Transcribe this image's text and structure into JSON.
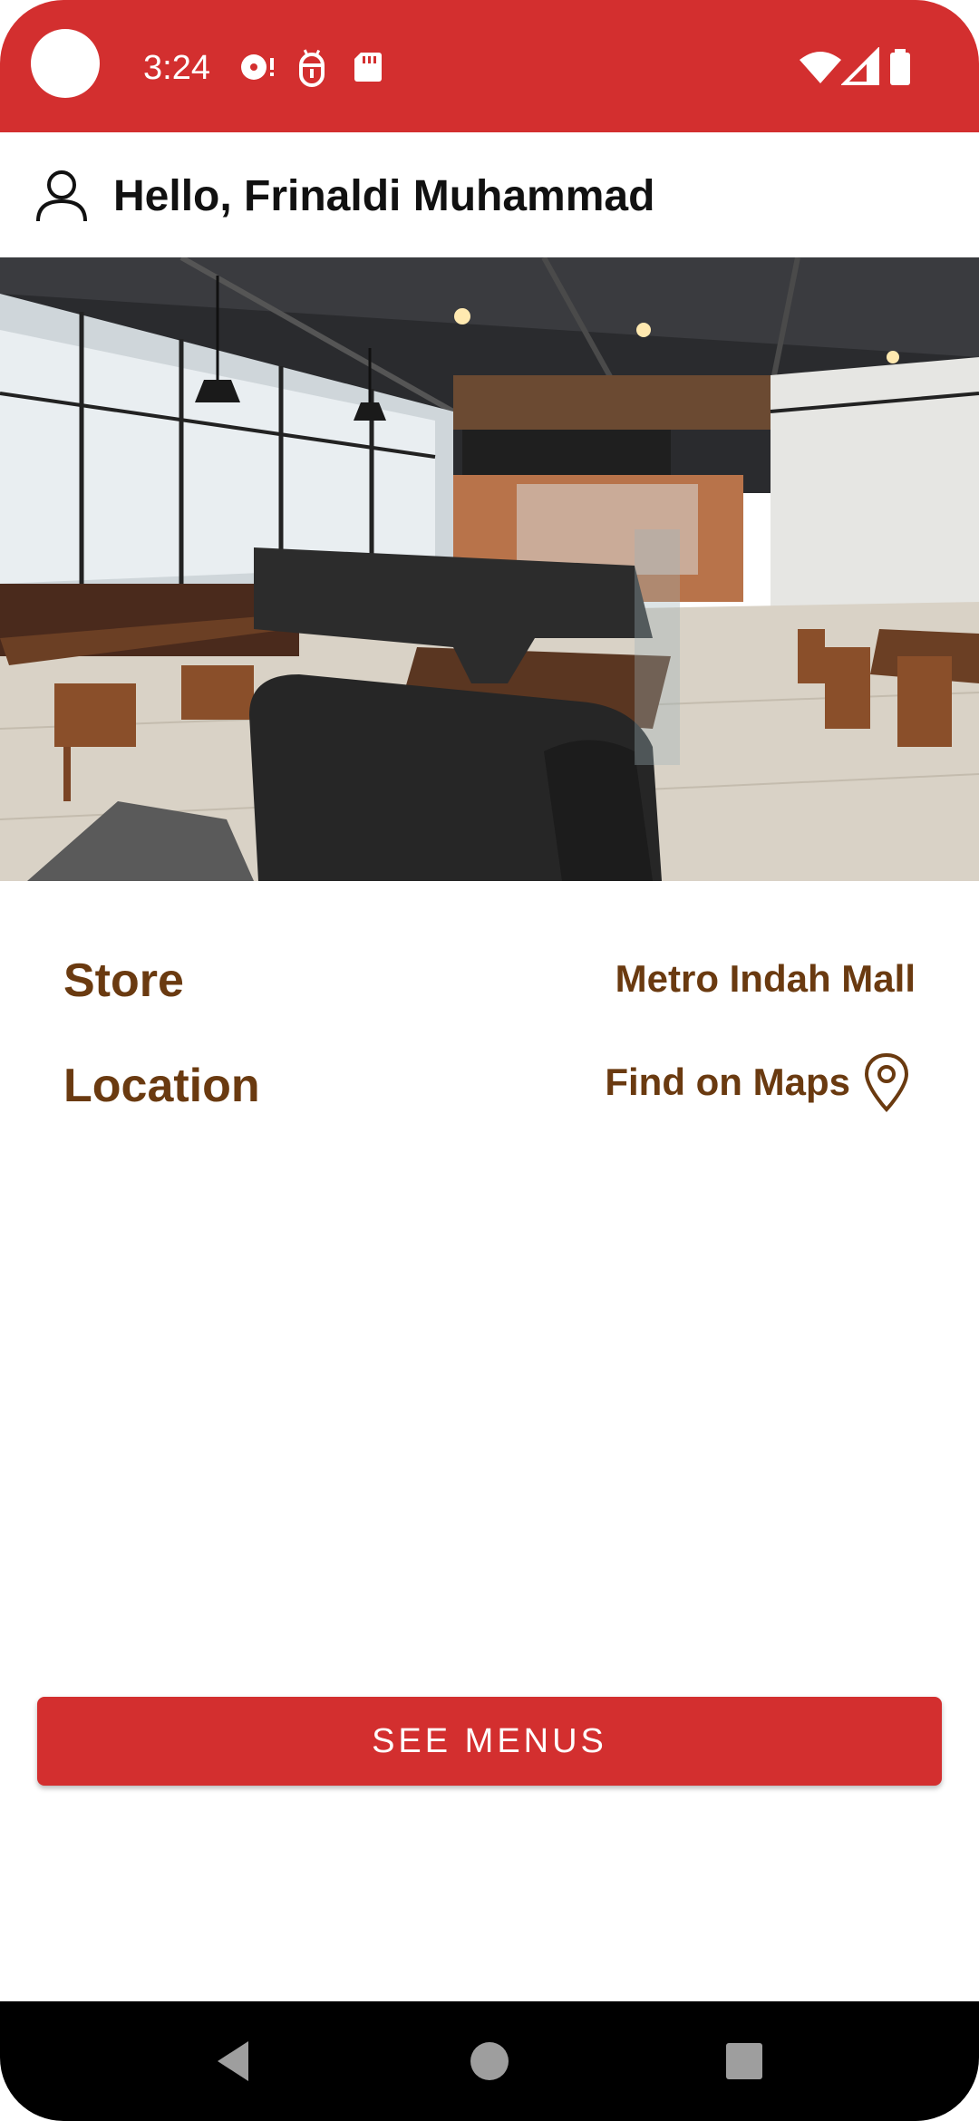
{
  "colors": {
    "brand_red": "#d32f2f",
    "accent_brown": "#6a3a10"
  },
  "status_bar": {
    "time": "3:24",
    "icons": [
      "camera-cutout",
      "sync-alert-icon",
      "android-debug-icon",
      "sd-card-icon",
      "wifi-icon",
      "cellular-signal-icon",
      "battery-icon"
    ]
  },
  "header": {
    "greeting": "Hello, Frinaldi Muhammad",
    "icon": "user-icon"
  },
  "hero": {
    "image": "restaurant-interior-photo"
  },
  "details": {
    "store_label": "Store",
    "store_value": "Metro Indah Mall",
    "location_label": "Location",
    "location_link": "Find on Maps",
    "location_icon": "map-pin-icon"
  },
  "actions": {
    "see_menus_label": "SEE MENUS"
  },
  "nav_bar": {
    "icons": [
      "back-icon",
      "home-icon",
      "recents-icon"
    ]
  }
}
